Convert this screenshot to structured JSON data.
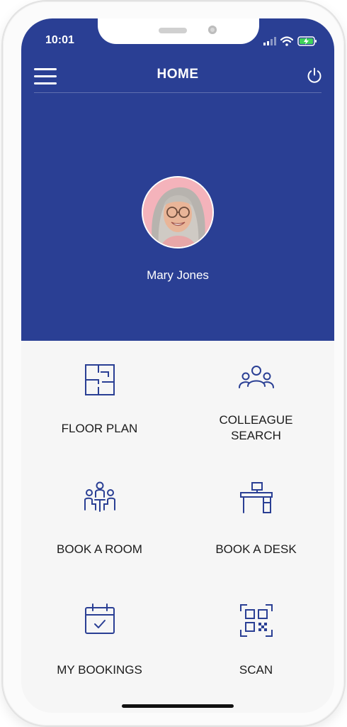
{
  "status_bar": {
    "time": "10:01"
  },
  "header": {
    "title": "HOME"
  },
  "user": {
    "name": "Mary Jones"
  },
  "tiles": [
    {
      "label": "FLOOR PLAN",
      "icon": "floor-plan-icon"
    },
    {
      "label": "COLLEAGUE SEARCH",
      "icon": "colleagues-icon"
    },
    {
      "label": "BOOK A ROOM",
      "icon": "meeting-room-icon"
    },
    {
      "label": "BOOK A DESK",
      "icon": "desk-icon"
    },
    {
      "label": "MY BOOKINGS",
      "icon": "calendar-check-icon"
    },
    {
      "label": "SCAN",
      "icon": "qr-code-icon"
    }
  ],
  "colors": {
    "header": "#2a3f94",
    "icon_stroke": "#2a3f94",
    "background": "#f6f6f6"
  }
}
